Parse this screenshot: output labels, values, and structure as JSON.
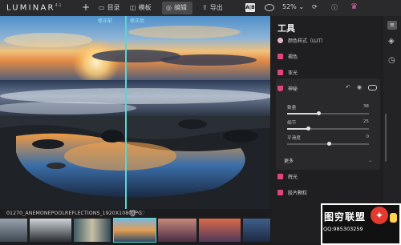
{
  "app": {
    "name": "LUMINAR",
    "version": "4.1"
  },
  "toolbar": {
    "add_label": "+",
    "library_label": "目录",
    "templates_label": "模板",
    "edit_label": "编辑",
    "export_label": "导出",
    "zoom_label": "52%",
    "compare_label": "A|B"
  },
  "canvas": {
    "before_label": "修正前",
    "after_label": "修正后"
  },
  "file": {
    "name": "01270_ANEMONEPOOLREFLECTIONS_1920X1080.JPG"
  },
  "panel": {
    "title": "工具",
    "sections": [
      {
        "label": "颜色样式（LUT）",
        "icon_color": "#e7b7c8"
      },
      {
        "label": "褐色",
        "icon_color": "#e2457c"
      },
      {
        "label": "亚光",
        "icon_color": "#e2457c"
      }
    ],
    "active_tool": {
      "label": "神秘",
      "icon_color": "#e2457c",
      "sliders": [
        {
          "label": "数量",
          "value": "38",
          "fraction": 0.38
        },
        {
          "label": "细节",
          "value": "25",
          "fraction": 0.25
        },
        {
          "label": "平滑度",
          "value": "0",
          "fraction": 0.0
        }
      ],
      "footer_label": "更多"
    },
    "after_sections": [
      {
        "label": "辉光",
        "icon_color": "#e2457c"
      },
      {
        "label": "胶片颗粒",
        "icon_color": "#e2457c"
      }
    ]
  },
  "watermark": {
    "title": "图穷联盟",
    "qq": "QQ:985303259"
  }
}
